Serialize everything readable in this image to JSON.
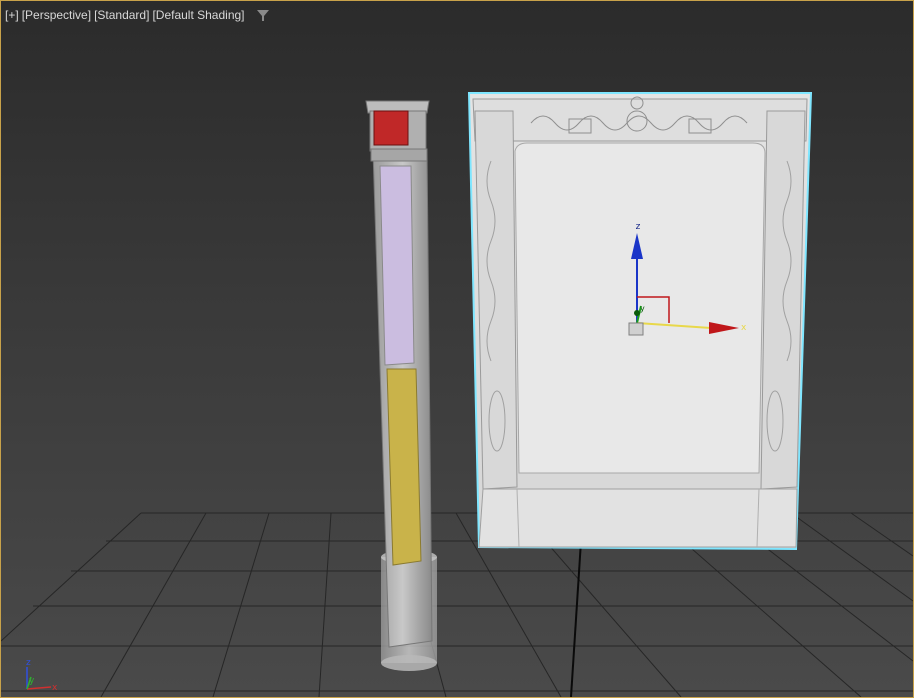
{
  "viewport": {
    "label_items": [
      "[+]",
      "[Perspective]",
      "[Standard]",
      "[Default Shading]"
    ],
    "filter_icon": "filter-icon",
    "selection_color": "#7fe6ff",
    "accent_colors": {
      "border": "#c8a24a",
      "column_cap": "#c02828",
      "column_purple_panel": "#cbbde0",
      "column_yellow_panel": "#c9b34a",
      "gizmo_x": "#c0171a",
      "gizmo_y": "#1aa01a",
      "gizmo_z": "#1a35c8"
    }
  },
  "gizmo": {
    "x_label": "x",
    "y_label": "y",
    "z_label": "z"
  },
  "corner_axes": {
    "x_label": "x",
    "y_label": "y",
    "z_label": "z"
  }
}
